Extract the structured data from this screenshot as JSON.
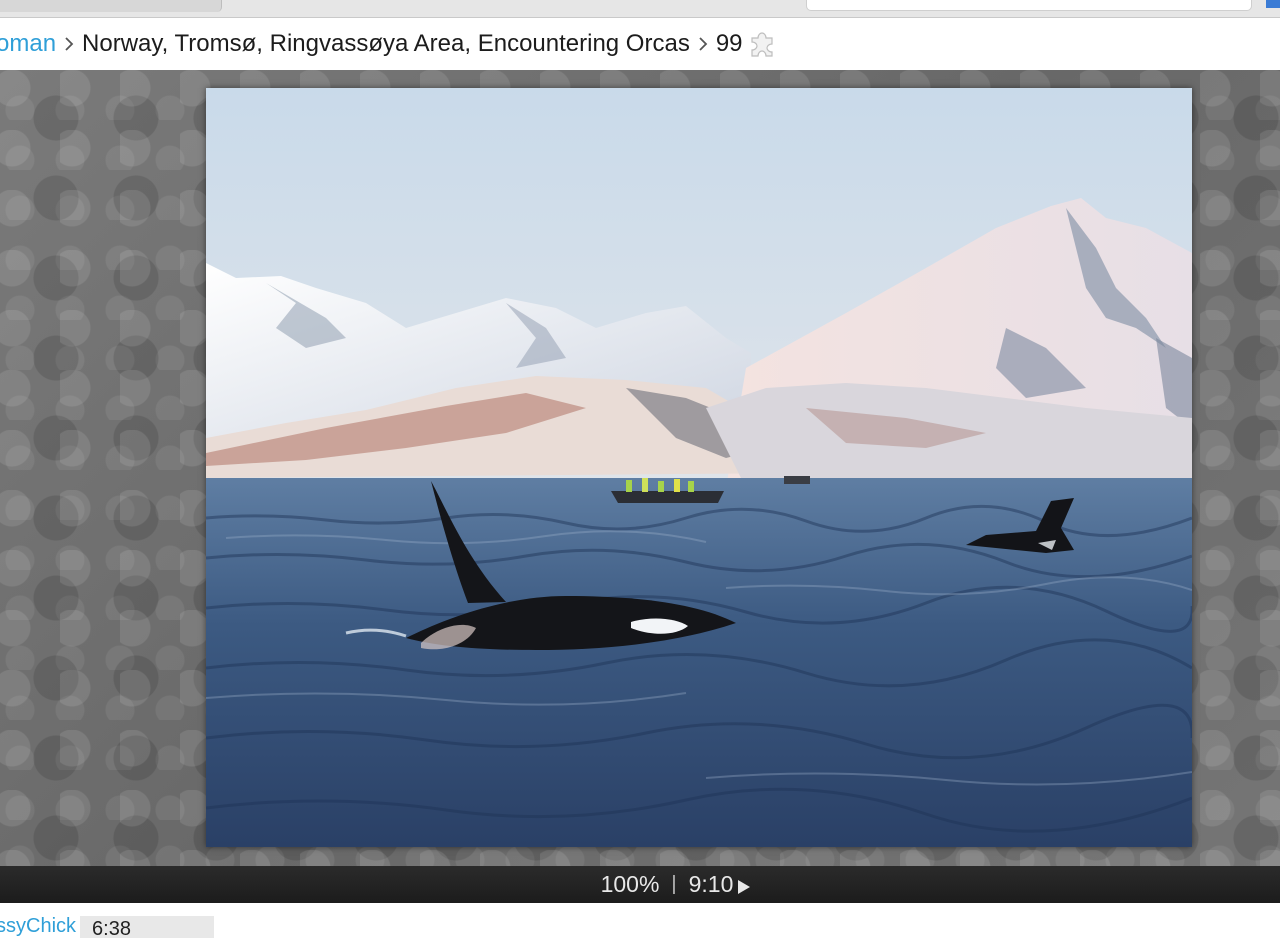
{
  "breadcrumb": {
    "parent_label": "oman",
    "current_label": "Norway, Tromsø, Ringvassøya Area, Encountering Orcas",
    "piece_count": "99",
    "count_icon": "puzzle-piece-icon"
  },
  "player": {
    "zoom": "100%",
    "divider": "|",
    "time": "9:10",
    "play_icon": "play-icon"
  },
  "leaderboard": {
    "user": "ssyChick",
    "time": "6:38"
  },
  "colors": {
    "link": "#2f9fd8",
    "control_bar": "#222222",
    "stage_bg": "#6f6f6f"
  }
}
